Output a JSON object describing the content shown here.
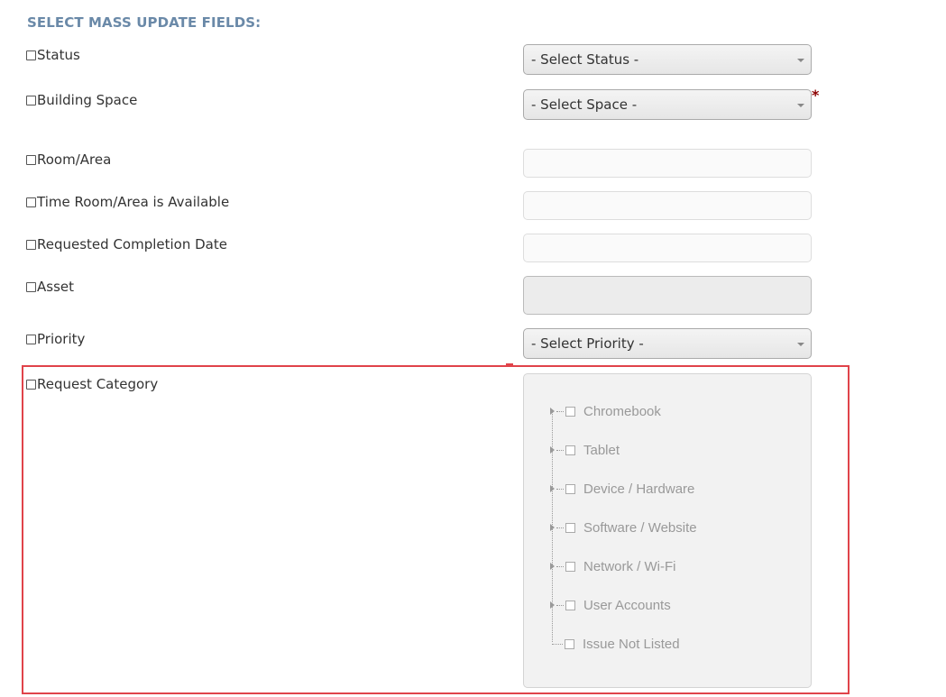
{
  "header": {
    "title": "SELECT MASS UPDATE FIELDS:"
  },
  "fields": {
    "status": {
      "label": "Status",
      "select_value": "- Select Status -"
    },
    "building_space": {
      "label": "Building Space",
      "select_value": "- Select Space -",
      "required_mark": "*"
    },
    "room_area": {
      "label": "Room/Area",
      "value": ""
    },
    "time_available": {
      "label": "Time Room/Area is Available",
      "value": ""
    },
    "completion_date": {
      "label": "Requested Completion Date",
      "value": ""
    },
    "asset": {
      "label": "Asset",
      "value": ""
    },
    "priority": {
      "label": "Priority",
      "select_value": "- Select Priority -"
    },
    "request_category": {
      "label": "Request Category"
    }
  },
  "category_tree": {
    "items": [
      {
        "label": "Chromebook",
        "expandable": true
      },
      {
        "label": "Tablet",
        "expandable": true
      },
      {
        "label": "Device / Hardware",
        "expandable": true
      },
      {
        "label": "Software / Website",
        "expandable": true
      },
      {
        "label": "Network / Wi-Fi",
        "expandable": true
      },
      {
        "label": "User Accounts",
        "expandable": true
      },
      {
        "label": "Issue Not Listed",
        "expandable": false
      }
    ]
  },
  "colors": {
    "title": "#6a89a8",
    "highlight": "#e0434a",
    "required": "#8b0000"
  }
}
